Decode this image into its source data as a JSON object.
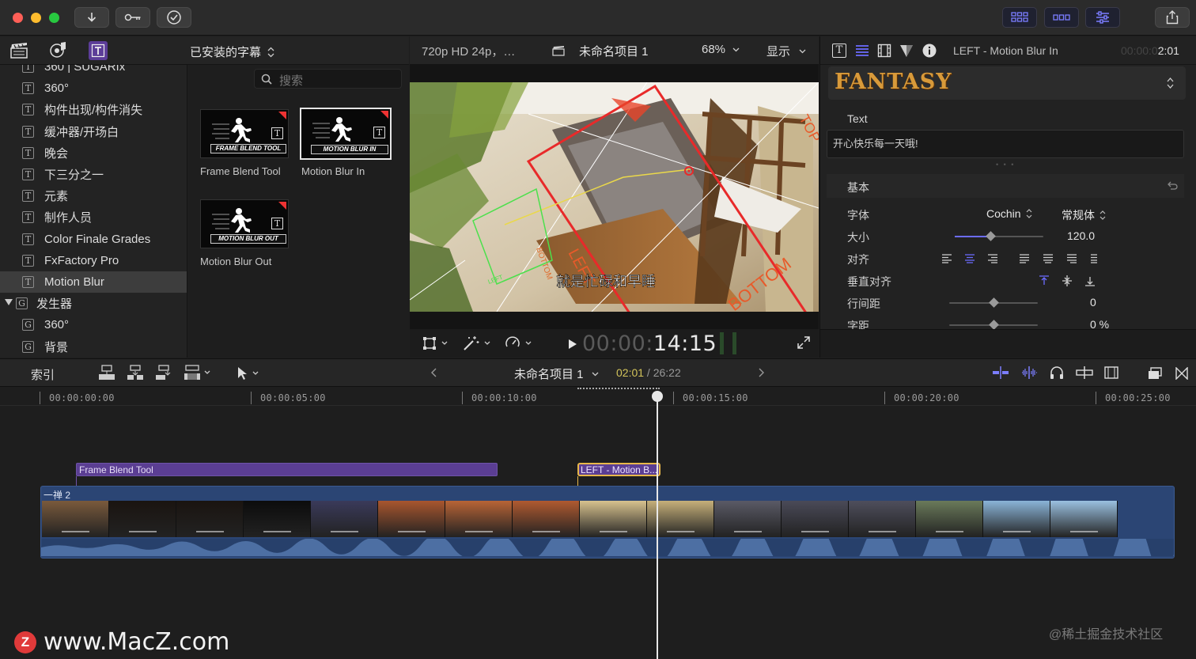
{
  "toolbar": {
    "buttons": [
      "download-icon",
      "key-icon",
      "checkmark-icon"
    ],
    "right_buttons": [
      "grid-layout-icon",
      "filmstrip-icon",
      "sliders-icon",
      "share-icon"
    ]
  },
  "browser": {
    "tabs": [
      "clapper-icon",
      "photos-music-icon",
      "titles-icon"
    ],
    "category_title": "已安装的字幕",
    "search_placeholder": "搜索",
    "sidebar_items": [
      {
        "label": "360 | SUGARfx",
        "sel": false,
        "icon": "T"
      },
      {
        "label": "360°",
        "sel": false,
        "icon": "T"
      },
      {
        "label": "构件出现/构件消失",
        "sel": false,
        "icon": "T"
      },
      {
        "label": "缓冲器/开场白",
        "sel": false,
        "icon": "T"
      },
      {
        "label": "晚会",
        "sel": false,
        "icon": "T"
      },
      {
        "label": "下三分之一",
        "sel": false,
        "icon": "T"
      },
      {
        "label": "元素",
        "sel": false,
        "icon": "T"
      },
      {
        "label": "制作人员",
        "sel": false,
        "icon": "T"
      },
      {
        "label": "Color Finale Grades",
        "sel": false,
        "icon": "T"
      },
      {
        "label": "FxFactory Pro",
        "sel": false,
        "icon": "T"
      },
      {
        "label": "Motion Blur",
        "sel": true,
        "icon": "T"
      },
      {
        "label": "发生器",
        "sel": false,
        "icon": "G",
        "group": true
      },
      {
        "label": "360°",
        "sel": false,
        "icon": "G"
      },
      {
        "label": "背景",
        "sel": false,
        "icon": "G"
      }
    ],
    "thumbnails": [
      {
        "name": "Frame Blend Tool",
        "banner": "FRAME BLEND TOOL",
        "selected": false
      },
      {
        "name": "Motion Blur In",
        "banner": "MOTION BLUR IN",
        "selected": true
      },
      {
        "name": "Motion Blur Out",
        "banner": "MOTION BLUR OUT",
        "selected": false
      }
    ]
  },
  "viewer": {
    "format": "720p HD 24p，…",
    "project_name": "未命名项目 1",
    "zoom": "68%",
    "display_label": "显示",
    "subtitle_text": "就是忙碌和早睡",
    "overlay_labels": {
      "left": "LEFT",
      "bottom": "BOTTOM",
      "top": "TOP",
      "right": "RIGHT"
    },
    "timecode_dim": "00:00:",
    "timecode_bright": "14:15"
  },
  "inspector": {
    "tabs": [
      "text-icon",
      "paragraph-icon",
      "film-icon",
      "color-icon",
      "info-icon"
    ],
    "clip_name": "LEFT - Motion Blur In",
    "duration_dim": "00:00:0",
    "duration_bright": "2:01",
    "preset_name": "FANTASY",
    "text_section_label": "Text",
    "text_value": "开心快乐每一天哦!",
    "section_basic": "基本",
    "font_label": "字体",
    "font_family": "Cochin",
    "font_style": "常规体",
    "size_label": "大小",
    "size_value": "120.0",
    "size_fraction": 0.4,
    "align_label": "对齐",
    "valign_label": "垂直对齐",
    "line_spacing_label": "行间距",
    "line_spacing_value": "0",
    "tracking_label": "字距",
    "tracking_value": "0 %"
  },
  "timeline": {
    "index_label": "索引",
    "project_name": "未命名项目 1",
    "time_current": "02:01",
    "time_total": "26:22",
    "ruler_labels": [
      "00:00:00:00",
      "00:00:05:00",
      "00:00:10:00",
      "00:00:15:00",
      "00:00:20:00",
      "00:00:25:00"
    ],
    "title_clips": [
      {
        "label": "Frame Blend Tool"
      },
      {
        "label": "LEFT - Motion B..."
      }
    ],
    "primary_clip_label": "一禅 2"
  },
  "watermark": {
    "site": "www.MacZ.com",
    "logo_letter": "Z",
    "credit": "@稀土掘金技术社区"
  },
  "colors": {
    "accent_purple": "#5c3d98",
    "selected_clip_border": "#e8b84a",
    "timecode_yellow": "#d2c35a",
    "fantasy_gold": "#d89a3a"
  }
}
